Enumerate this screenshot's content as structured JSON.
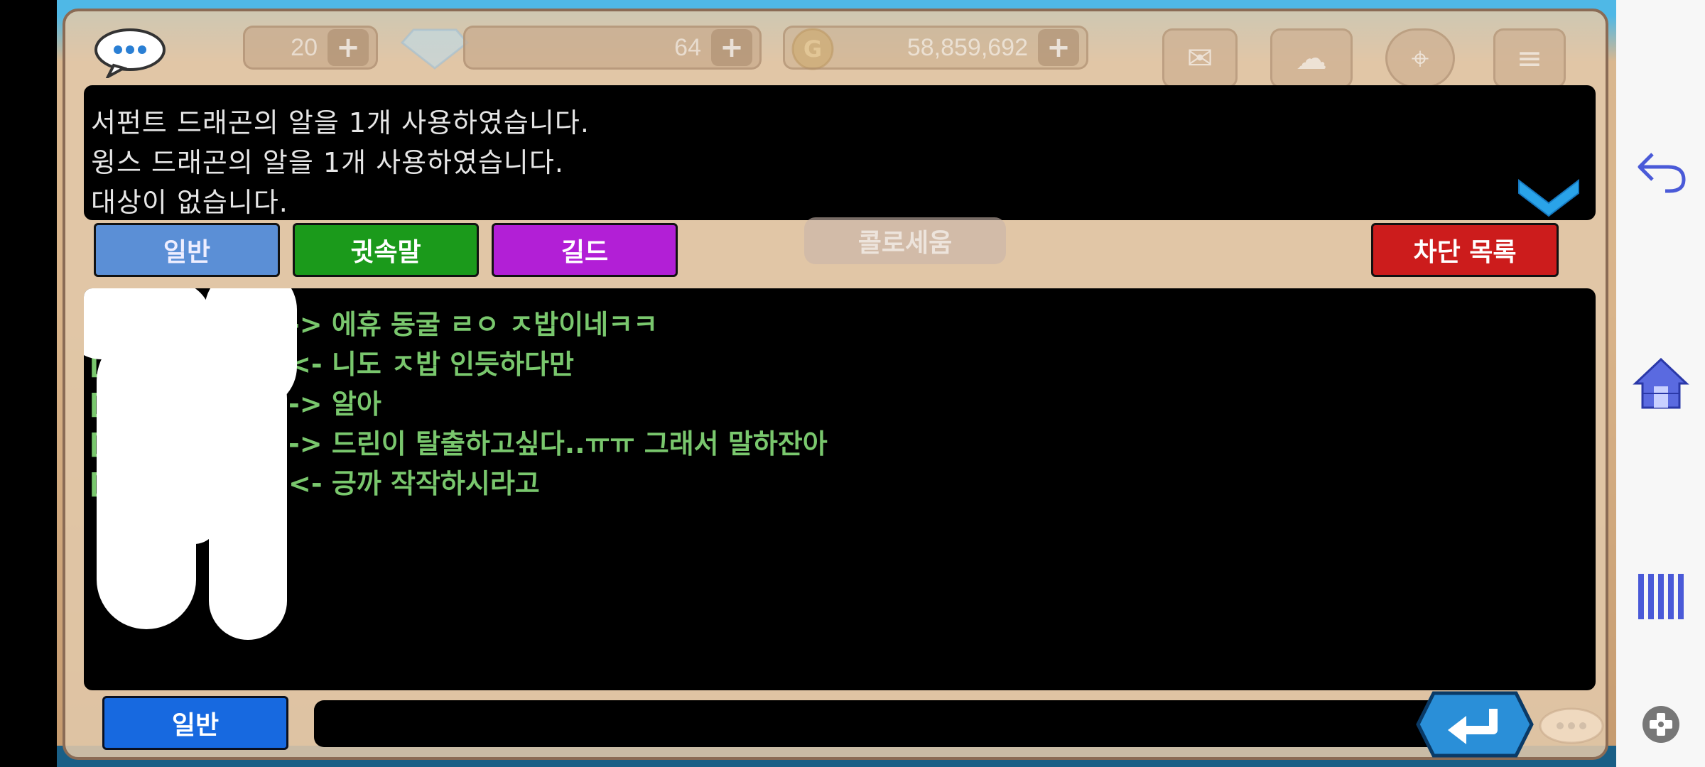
{
  "hud": {
    "stamina": "20",
    "gems": "64",
    "gold": "58,859,692",
    "icons": [
      "chat-bubble-icon",
      "heart-plus-icon",
      "diamond-icon",
      "coin-icon",
      "mail-icon",
      "cloud-icon",
      "map-marker-icon",
      "menu-icon"
    ]
  },
  "system_messages": [
    "서펀트 드래곤의 알을 1개 사용하였습니다.",
    "윙스 드래곤의 알을 1개 사용하였습니다.",
    "대상이 없습니다."
  ],
  "tabs": {
    "normal": "일반",
    "whisper": "귓속말",
    "guild": "길드",
    "block_list": "차단 목록"
  },
  "background_label": "콜로세움",
  "chat_log": [
    {
      "prefix": "[",
      "arrow": "->",
      "text": "에휴 동굴 ㄹㅇ ㅈ밥이네ㅋㅋ"
    },
    {
      "prefix": "[",
      "arrow": "<-",
      "text": "니도 ㅈ밥 인듯하다만"
    },
    {
      "prefix": "[",
      "arrow": "->",
      "text": "알아"
    },
    {
      "prefix": "[",
      "arrow": "->",
      "text": "드린이 탈출하고싶다..ㅠㅠ 그래서 말하잔아"
    },
    {
      "prefix": "[",
      "arrow": "<-",
      "text": "긍까 작작하시라고"
    }
  ],
  "input": {
    "channel_label": "일반",
    "value": "",
    "placeholder": ""
  },
  "colors": {
    "chat_green": "#79c76d",
    "tab_normal": "#5b8fd6",
    "tab_whisper": "#1b9a1b",
    "tab_guild": "#b21fd6",
    "tab_block": "#cc1c1c",
    "channel_button": "#1769e0",
    "send_button": "#2a8fd8"
  },
  "system_nav": [
    "back-icon",
    "home-icon",
    "recent-apps-icon",
    "game-tools-icon"
  ]
}
